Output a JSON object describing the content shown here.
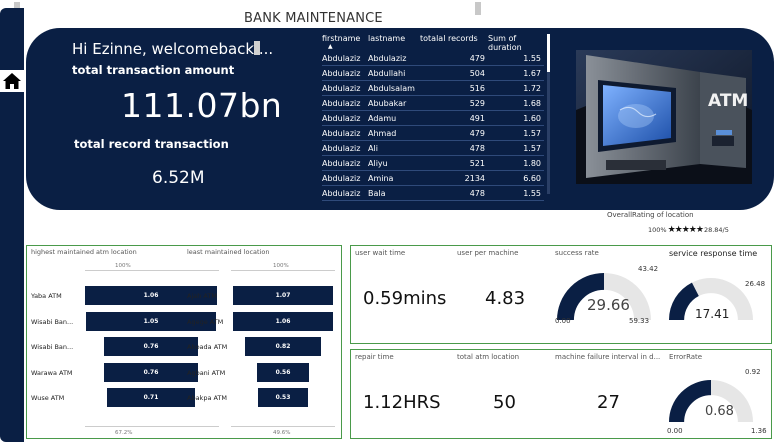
{
  "page": {
    "title": "BANK MAINTENANCE"
  },
  "hero": {
    "welcome": "Hi Ezinne, welcomeback....",
    "amount_label": "total transaction amount",
    "amount_value": "111.07bn",
    "records_label": "total record transaction",
    "records_value": "6.52M"
  },
  "table": {
    "columns": [
      "firstname",
      "lastname",
      "totalal records",
      "Sum of duration"
    ],
    "rows": [
      [
        "Abdulaziz",
        "Abdulaziz",
        "479",
        "1.55"
      ],
      [
        "Abdulaziz",
        "Abdullahi",
        "504",
        "1.67"
      ],
      [
        "Abdulaziz",
        "Abdulsalam",
        "516",
        "1.72"
      ],
      [
        "Abdulaziz",
        "Abubakar",
        "529",
        "1.68"
      ],
      [
        "Abdulaziz",
        "Adamu",
        "491",
        "1.60"
      ],
      [
        "Abdulaziz",
        "Ahmad",
        "479",
        "1.57"
      ],
      [
        "Abdulaziz",
        "Ali",
        "478",
        "1.57"
      ],
      [
        "Abdulaziz",
        "Aliyu",
        "521",
        "1.80"
      ],
      [
        "Abdulaziz",
        "Amina",
        "2134",
        "6.60"
      ],
      [
        "Abdulaziz",
        "Bala",
        "478",
        "1.55"
      ]
    ]
  },
  "atm_image": {
    "screen_text": "ATM",
    "icon": "atm-machine-image"
  },
  "rating": {
    "label": "OverallRating of location",
    "prefix": "100%",
    "stars": "★★★★★",
    "suffix": "28.84/5"
  },
  "funnels": {
    "highest": {
      "title": "highest maintained atm location",
      "top_pct": "100%",
      "bottom_pct": "67.2%",
      "items": [
        {
          "label": "Yaba ATM",
          "value": "1.06"
        },
        {
          "label": "Wisabi Ban...",
          "value": "1.05"
        },
        {
          "label": "Wisabi Ban...",
          "value": "0.76"
        },
        {
          "label": "Warawa ATM",
          "value": "0.76"
        },
        {
          "label": "Wuse ATM",
          "value": "0.71"
        }
      ]
    },
    "least": {
      "title": "least maintained location",
      "top_pct": "100%",
      "bottom_pct": "49.6%",
      "items": [
        {
          "label": "Ajah ATM",
          "value": "1.07"
        },
        {
          "label": "Agege ATM",
          "value": "1.06"
        },
        {
          "label": "Ahoada ATM",
          "value": "0.82"
        },
        {
          "label": "Agbani ATM",
          "value": "0.56"
        },
        {
          "label": "Abakpa ATM",
          "value": "0.53"
        }
      ]
    }
  },
  "kpis_top": {
    "wait": {
      "label": "user wait time",
      "value": "0.59mins"
    },
    "per_machine": {
      "label": "user per machine",
      "value": "4.83"
    },
    "success": {
      "label": "success rate",
      "value": "29.66",
      "min": "0.00",
      "max": "59.33",
      "target": "43.42",
      "fraction": 0.5
    },
    "response": {
      "label": "service response time",
      "value": "17.41",
      "target": "26.48",
      "fraction": 0.35
    }
  },
  "kpis_bot": {
    "repair": {
      "label": "repair time",
      "value": "1.12HRS"
    },
    "total_loc": {
      "label": "total atm location",
      "value": "50"
    },
    "failure": {
      "label": "machine failure interval in d...",
      "value": "27"
    },
    "error": {
      "label": "ErrorRate",
      "value": "0.68",
      "min": "0.00",
      "max": "1.36",
      "target": "0.92",
      "fraction": 0.5
    }
  },
  "colors": {
    "navy": "#0a1f44",
    "gauge_bg": "#e6e6e6",
    "panel_border": "#4a9a4a"
  }
}
